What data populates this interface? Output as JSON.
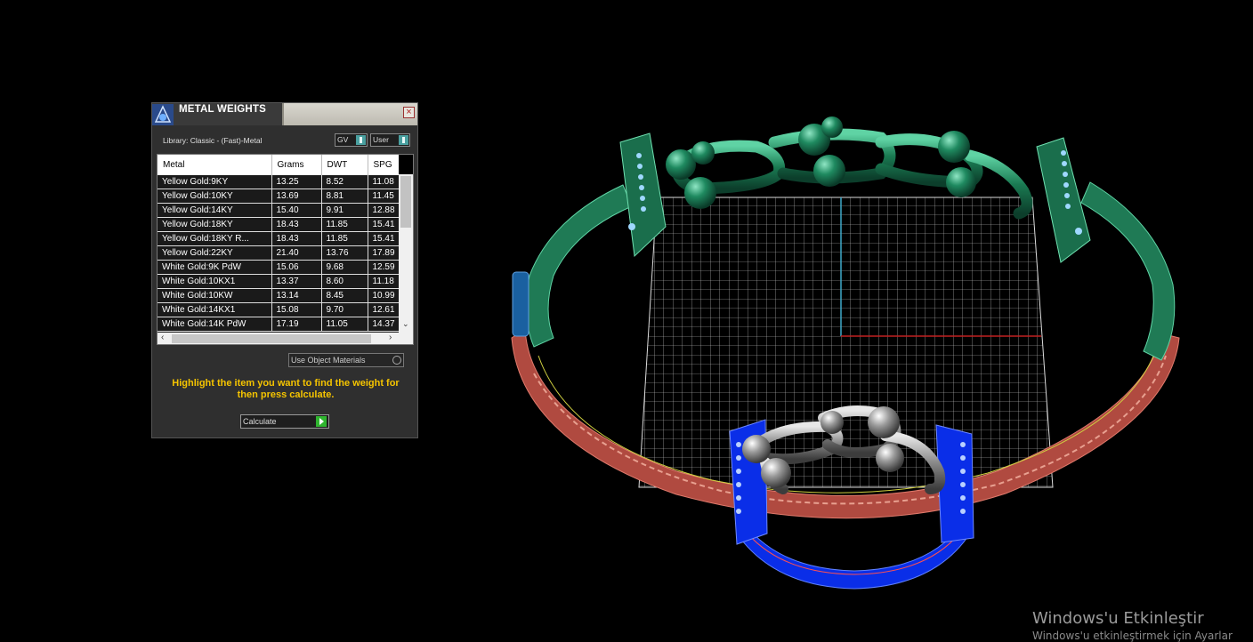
{
  "dialog": {
    "title": "METAL WEIGHTS",
    "close_glyph": "×",
    "library_label": "Library: Classic - (Fast)-Metal",
    "gv_dropdown": "GV",
    "user_dropdown": "User",
    "columns": [
      "Metal",
      "Grams",
      "DWT",
      "SPG"
    ],
    "rows": [
      [
        "Yellow Gold:9KY",
        "13.25",
        "8.52",
        "11.08"
      ],
      [
        "Yellow Gold:10KY",
        "13.69",
        "8.81",
        "11.45"
      ],
      [
        "Yellow Gold:14KY",
        "15.40",
        "9.91",
        "12.88"
      ],
      [
        "Yellow Gold:18KY",
        "18.43",
        "11.85",
        "15.41"
      ],
      [
        "Yellow Gold:18KY R...",
        "18.43",
        "11.85",
        "15.41"
      ],
      [
        "Yellow Gold:22KY",
        "21.40",
        "13.76",
        "17.89"
      ],
      [
        "White Gold:9K PdW",
        "15.06",
        "9.68",
        "12.59"
      ],
      [
        "White Gold:10KX1",
        "13.37",
        "8.60",
        "11.18"
      ],
      [
        "White Gold:10KW",
        "13.14",
        "8.45",
        "10.99"
      ],
      [
        "White Gold:14KX1",
        "15.08",
        "9.70",
        "12.61"
      ],
      [
        "White Gold:14K PdW",
        "17.19",
        "11.05",
        "14.37"
      ]
    ],
    "use_object_materials": "Use Object Materials",
    "hint": "Highlight the item you want to find the weight for then press calculate.",
    "calculate_label": "Calculate"
  },
  "watermark": {
    "title": "Windows'u Etkinleştir",
    "subtitle": "Windows'u etkinleştirmek için Ayarlar"
  },
  "colors": {
    "hint": "#f5c400",
    "green_band": "#1f7a55",
    "red_band": "#b14a40",
    "blue_part": "#0a2ee8",
    "grid": "#ffffff"
  }
}
